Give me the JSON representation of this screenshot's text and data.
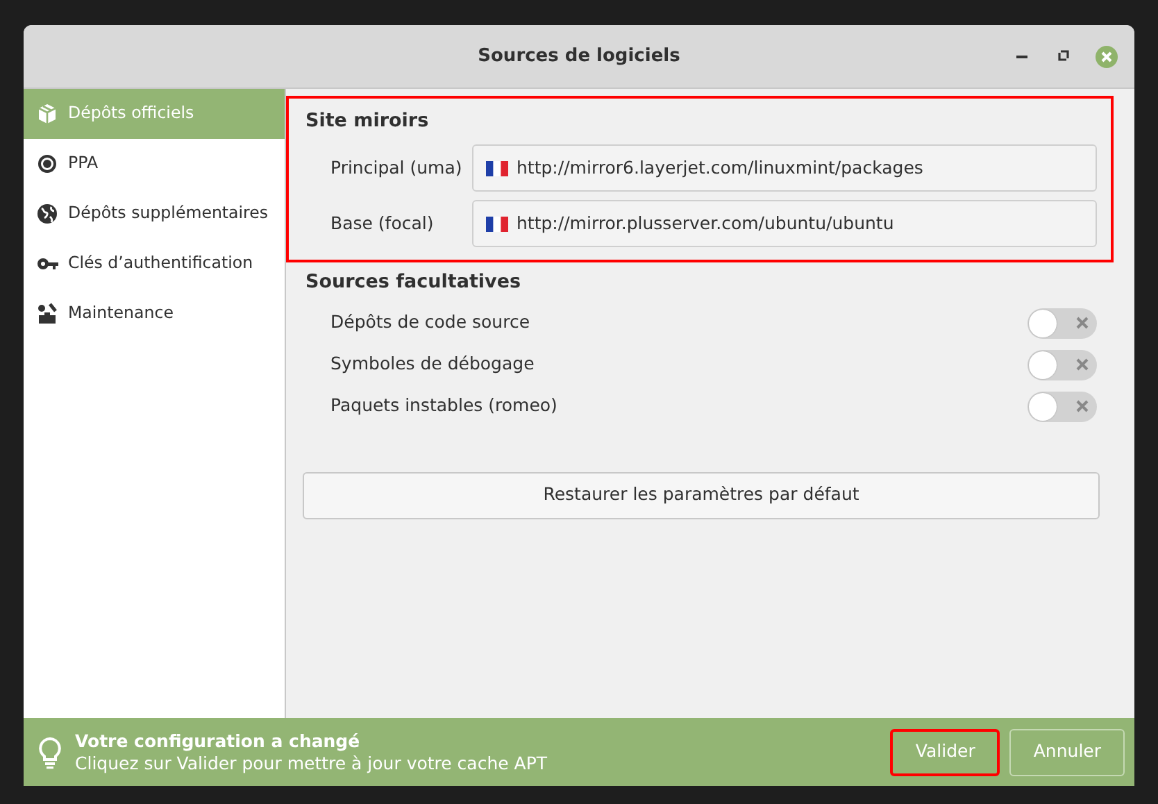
{
  "window": {
    "title": "Sources de logiciels"
  },
  "sidebar": {
    "items": [
      {
        "label": "Dépôts officiels",
        "selected": true
      },
      {
        "label": "PPA",
        "selected": false
      },
      {
        "label": "Dépôts supplémentaires",
        "selected": false
      },
      {
        "label": "Clés d’authentification",
        "selected": false
      },
      {
        "label": "Maintenance",
        "selected": false
      }
    ]
  },
  "mirrors": {
    "title": "Site miroirs",
    "highlighted": true,
    "rows": [
      {
        "label": "Principal (uma)",
        "value": "http://mirror6.layerjet.com/linuxmint/packages"
      },
      {
        "label": "Base (focal)",
        "value": "http://mirror.plusserver.com/ubuntu/ubuntu"
      }
    ]
  },
  "optional": {
    "title": "Sources facultatives",
    "rows": [
      {
        "label": "Dépôts de code source",
        "on": false
      },
      {
        "label": "Symboles de débogage",
        "on": false
      },
      {
        "label": "Paquets instables (romeo)",
        "on": false
      }
    ]
  },
  "restore_button": "Restaurer les paramètres par défaut",
  "info_bar": {
    "title": "Votre configuration a changé",
    "message": "Cliquez sur Valider pour mettre à jour votre cache APT",
    "buttons": [
      {
        "label": "Valider",
        "highlighted": true
      },
      {
        "label": "Annuler",
        "highlighted": false
      }
    ]
  }
}
